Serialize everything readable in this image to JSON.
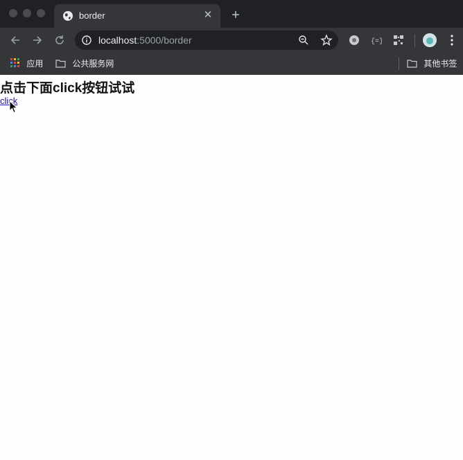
{
  "browser": {
    "tab": {
      "title": "border",
      "favicon": "globe-icon"
    },
    "address": {
      "host": "localhost",
      "rest": ":5000/border"
    },
    "bookmarks": {
      "apps_label": "应用",
      "folder1": "公共服务网",
      "other": "其他书签"
    },
    "colors": {
      "frame": "#202124",
      "toolbar": "#35363a"
    }
  },
  "page": {
    "heading": "点击下面click按钮试试",
    "link": "click"
  }
}
